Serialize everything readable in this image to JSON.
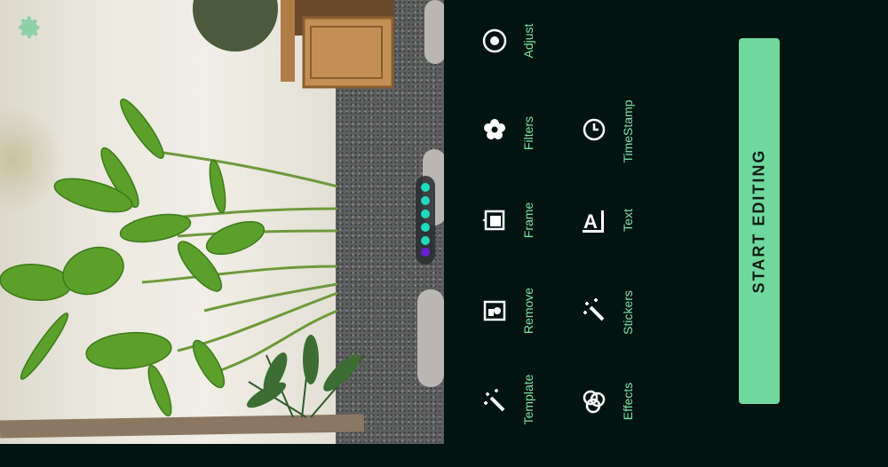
{
  "slider": {
    "dots": 6,
    "active_index": 5
  },
  "tools": [
    {
      "id": "adjust",
      "label": "Adjust",
      "icon": "adjust-icon"
    },
    {
      "id": "timestamp",
      "label": "TimeStamp",
      "icon": "clock-icon"
    },
    {
      "id": "filters",
      "label": "Filters",
      "icon": "filters-icon"
    },
    {
      "id": "frame",
      "label": "Frame",
      "icon": "frame-icon"
    },
    {
      "id": "text",
      "label": "Text",
      "icon": "text-icon"
    },
    {
      "id": "remove",
      "label": "Remove",
      "icon": "remove-icon"
    },
    {
      "id": "stickers",
      "label": "Stickers",
      "icon": "stickers-icon"
    },
    {
      "id": "template",
      "label": "Template",
      "icon": "template-icon"
    },
    {
      "id": "effects",
      "label": "Effects",
      "icon": "effects-icon"
    }
  ],
  "start_button": {
    "label": "START EDITING"
  },
  "colors": {
    "background": "#021412",
    "accent": "#6fd99d",
    "label": "#7fe3a4",
    "slider_dot": "#1fd9c0",
    "slider_active": "#6a1fd0"
  }
}
